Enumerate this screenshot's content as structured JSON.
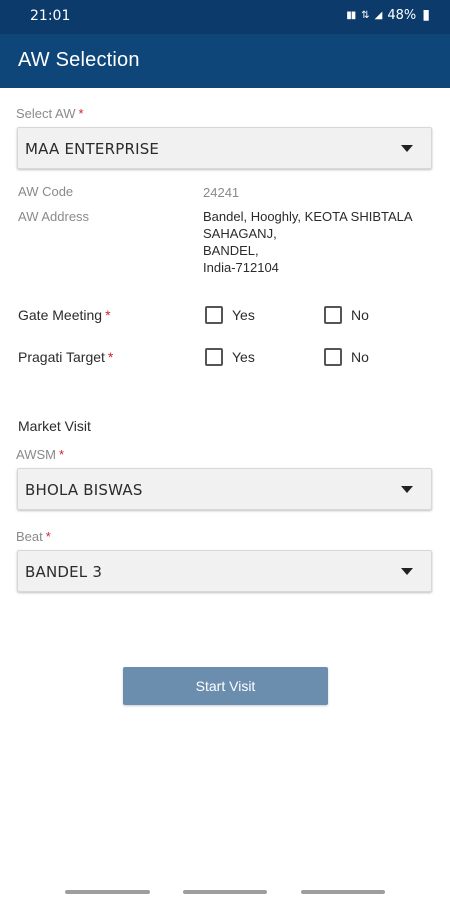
{
  "status_bar": {
    "time": "21:01",
    "battery": "48%"
  },
  "app_bar": {
    "title": "AW Selection"
  },
  "select_aw": {
    "label": "Select AW",
    "required_mark": "*",
    "value": "MAA ENTERPRISE"
  },
  "aw_code": {
    "label": "AW Code",
    "value": "24241"
  },
  "aw_address": {
    "label": "AW Address",
    "lines": [
      "Bandel, Hooghly, KEOTA SHIBTALA",
      "SAHAGANJ,",
      "BANDEL,",
      "India-712104"
    ]
  },
  "gate_meeting": {
    "label": "Gate Meeting",
    "required_mark": "*",
    "yes_label": "Yes",
    "no_label": "No",
    "yes_checked": false,
    "no_checked": false
  },
  "pragati_target": {
    "label": "Pragati Target",
    "required_mark": "*",
    "yes_label": "Yes",
    "no_label": "No",
    "yes_checked": false,
    "no_checked": false
  },
  "market_visit": {
    "title": "Market Visit",
    "awsm": {
      "label": "AWSM",
      "required_mark": "*",
      "value": "BHOLA BISWAS"
    },
    "beat": {
      "label": "Beat",
      "required_mark": "*",
      "value": "BANDEL 3"
    }
  },
  "start_button": {
    "label": "Start Visit"
  },
  "colors": {
    "status_bar": "#0b3a6b",
    "app_bar": "#0f4679",
    "button": "#6b8eaf",
    "required": "#d0232d"
  }
}
